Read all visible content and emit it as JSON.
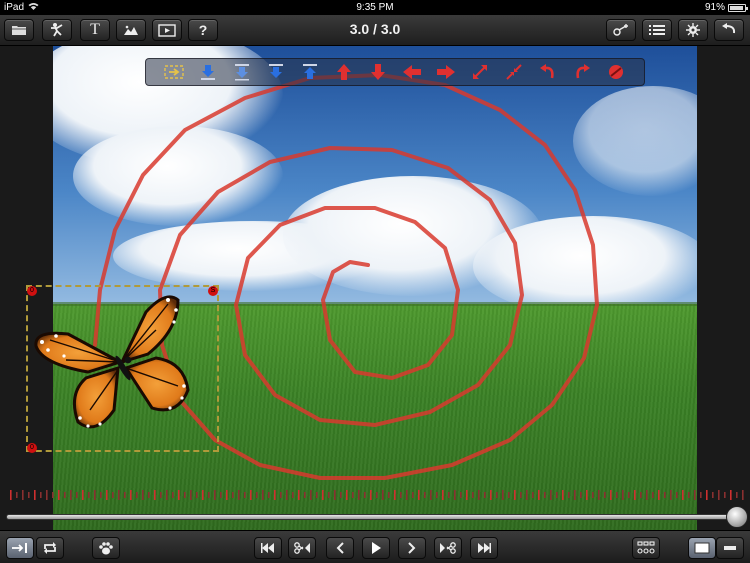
{
  "status_bar": {
    "device": "iPad",
    "time": "9:35 PM",
    "battery": "91%",
    "battery_level": 0.91
  },
  "header": {
    "time_readout": "3.0 / 3.0",
    "left_buttons": [
      {
        "name": "open-folder-button",
        "icon": "folder-icon"
      },
      {
        "name": "characters-button",
        "icon": "stickman-icon"
      },
      {
        "name": "text-button",
        "icon": "text-icon",
        "label": "T"
      },
      {
        "name": "backgrounds-button",
        "icon": "mountain-image-icon"
      },
      {
        "name": "preview-button",
        "icon": "play-screen-icon"
      },
      {
        "name": "help-button",
        "icon": "question-icon",
        "label": "?"
      }
    ],
    "right_buttons": [
      {
        "name": "edit-path-button",
        "icon": "path-node-icon"
      },
      {
        "name": "list-button",
        "icon": "list-icon"
      },
      {
        "name": "settings-button",
        "icon": "gear-bug-icon"
      },
      {
        "name": "undo-button",
        "icon": "undo-arrow-icon"
      }
    ]
  },
  "shape_toolbar": {
    "tools": [
      "select-move-icon",
      "arrow-down-bar-icon",
      "arrow-down-bar-alt-icon",
      "arrow-down-double-icon",
      "arrow-up-bar-icon",
      "arrow-up-red-icon",
      "arrow-down-red-icon",
      "arrow-left-red-icon",
      "arrow-right-red-icon",
      "expand-icon",
      "shrink-icon",
      "rotate-ccw-icon",
      "rotate-cw-icon",
      "remove-icon"
    ]
  },
  "selection": {
    "handle_top_left": "0",
    "handle_top_right": "S",
    "handle_bottom_left": "0"
  },
  "timeline": {
    "position": 1.0
  },
  "footer": {
    "left_buttons": [
      {
        "name": "frame-step-button",
        "icon": "arrow-to-bar-icon",
        "active": true
      },
      {
        "name": "loop-button",
        "icon": "loop-icon"
      },
      {
        "name": "paw-button",
        "icon": "paw-icon"
      }
    ],
    "transport": [
      {
        "name": "skip-to-start-button",
        "icon": "skip-start-icon"
      },
      {
        "name": "cut-back-button",
        "icon": "scissors-back-icon"
      },
      {
        "name": "step-back-button",
        "icon": "step-back-icon"
      },
      {
        "name": "play-button",
        "icon": "play-icon"
      },
      {
        "name": "step-forward-button",
        "icon": "step-forward-icon"
      },
      {
        "name": "cut-forward-button",
        "icon": "scissors-forward-icon"
      },
      {
        "name": "skip-to-end-button",
        "icon": "skip-end-icon"
      }
    ],
    "right_buttons": [
      {
        "name": "frames-overview-button",
        "icon": "frames-grid-icon"
      },
      {
        "name": "view-mode-large-button",
        "icon": "rect-large-icon",
        "active": true
      },
      {
        "name": "view-mode-small-button",
        "icon": "rect-small-icon"
      }
    ]
  },
  "colors": {
    "spiral_path": "#d83a2e",
    "selection_dash": "#b09a3a",
    "handle": "#d01010",
    "tool_arrow_blue": "#2a6fe0",
    "tool_arrow_red": "#e03030"
  }
}
